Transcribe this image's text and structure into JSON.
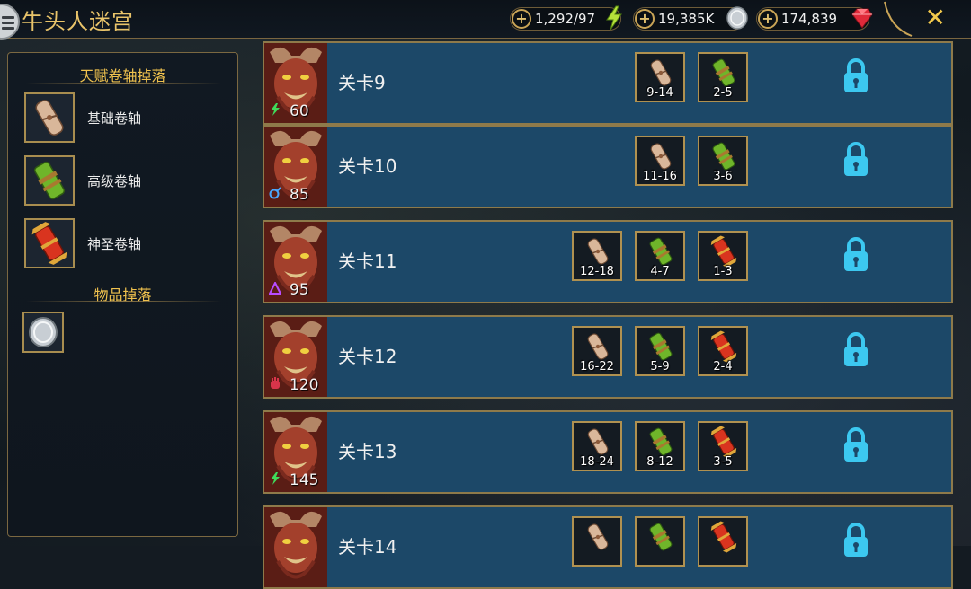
{
  "header": {
    "title": "牛头人迷宫",
    "resources": [
      {
        "value": "1,292/97",
        "icon": "energy-bolt-icon"
      },
      {
        "value": "19,385K",
        "icon": "silver-coin-icon"
      },
      {
        "value": "174,839",
        "icon": "ruby-gem-icon"
      }
    ],
    "close_label": "✕"
  },
  "sidebar": {
    "talent_title": "天赋卷轴掉落",
    "scrolls": [
      {
        "label": "基础卷轴",
        "icon": "basic-scroll-icon"
      },
      {
        "label": "高级卷轴",
        "icon": "advanced-scroll-icon"
      },
      {
        "label": "神圣卷轴",
        "icon": "sacred-scroll-icon"
      }
    ],
    "items_title": "物品掉落",
    "items": [
      {
        "icon": "silver-coin-icon"
      }
    ]
  },
  "stages": [
    {
      "name": "关卡9",
      "level": "60",
      "affinity": "force",
      "rewards": [
        {
          "type": "basic",
          "count": "9-14"
        },
        {
          "type": "advanced",
          "count": "2-5"
        }
      ]
    },
    {
      "name": "关卡10",
      "level": "85",
      "affinity": "magic",
      "rewards": [
        {
          "type": "basic",
          "count": "11-16"
        },
        {
          "type": "advanced",
          "count": "3-6"
        }
      ]
    },
    {
      "name": "关卡11",
      "level": "95",
      "affinity": "spirit",
      "rewards": [
        {
          "type": "basic",
          "count": "12-18"
        },
        {
          "type": "advanced",
          "count": "4-7"
        },
        {
          "type": "sacred",
          "count": "1-3"
        }
      ]
    },
    {
      "name": "关卡12",
      "level": "120",
      "affinity": "void",
      "rewards": [
        {
          "type": "basic",
          "count": "16-22"
        },
        {
          "type": "advanced",
          "count": "5-9"
        },
        {
          "type": "sacred",
          "count": "2-4"
        }
      ]
    },
    {
      "name": "关卡13",
      "level": "145",
      "affinity": "force",
      "rewards": [
        {
          "type": "basic",
          "count": "18-24"
        },
        {
          "type": "advanced",
          "count": "8-12"
        },
        {
          "type": "sacred",
          "count": "3-5"
        }
      ]
    },
    {
      "name": "关卡14",
      "level": "",
      "affinity": "",
      "rewards": [
        {
          "type": "basic",
          "count": ""
        },
        {
          "type": "advanced",
          "count": ""
        },
        {
          "type": "sacred",
          "count": ""
        }
      ]
    }
  ],
  "colors": {
    "accent_gold": "#f0c24e",
    "stage_bg": "#1c4868",
    "lock_blue": "#3cc8f0"
  }
}
